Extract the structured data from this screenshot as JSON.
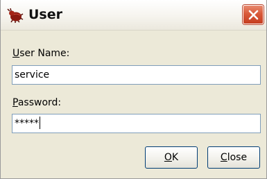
{
  "window": {
    "title": "User",
    "icon": "app-bug-icon",
    "close_icon": "close-icon",
    "close_color": "#d9553a"
  },
  "form": {
    "username": {
      "label_hotkey": "U",
      "label_rest": "ser Name:",
      "value": "service"
    },
    "password": {
      "label_hotkey": "P",
      "label_rest": "assword:",
      "masked_value": "*****"
    }
  },
  "buttons": {
    "ok": {
      "hotkey": "O",
      "rest": "K"
    },
    "close": {
      "hotkey": "C",
      "rest": "lose"
    }
  }
}
